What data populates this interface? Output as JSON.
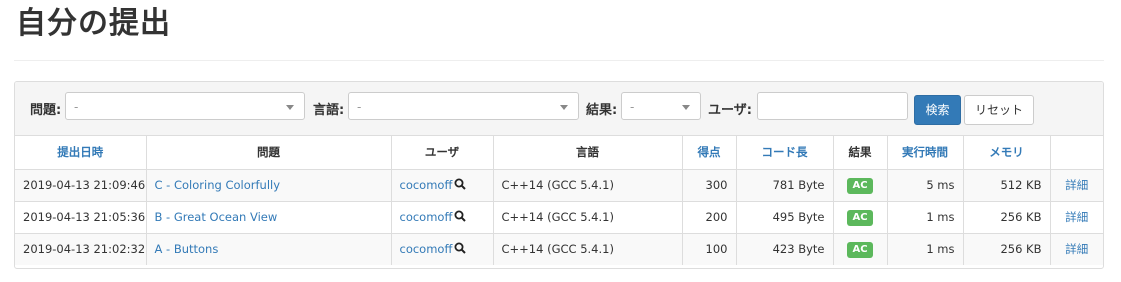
{
  "page": {
    "title": "自分の提出"
  },
  "filters": {
    "problem_label": "問題:",
    "problem_value": "-",
    "language_label": "言語:",
    "language_value": "-",
    "status_label": "結果:",
    "status_value": "-",
    "user_label": "ユーザ:",
    "user_value": "",
    "search_button": "検索",
    "reset_button": "リセット"
  },
  "table": {
    "headers": {
      "date": "提出日時",
      "problem": "問題",
      "user": "ユーザ",
      "language": "言語",
      "score": "得点",
      "code_length": "コード長",
      "status": "結果",
      "exec_time": "実行時間",
      "memory": "メモリ"
    },
    "rows": [
      {
        "date": "2019-04-13 21:09:46",
        "problem": "C - Coloring Colorfully",
        "user": "cocomoff",
        "language": "C++14 (GCC 5.4.1)",
        "score": "300",
        "code_length": "781 Byte",
        "status": "AC",
        "exec_time": "5 ms",
        "memory": "512 KB",
        "detail": "詳細"
      },
      {
        "date": "2019-04-13 21:05:36",
        "problem": "B - Great Ocean View",
        "user": "cocomoff",
        "language": "C++14 (GCC 5.4.1)",
        "score": "200",
        "code_length": "495 Byte",
        "status": "AC",
        "exec_time": "1 ms",
        "memory": "256 KB",
        "detail": "詳細"
      },
      {
        "date": "2019-04-13 21:02:32",
        "problem": "A - Buttons",
        "user": "cocomoff",
        "language": "C++14 (GCC 5.4.1)",
        "score": "100",
        "code_length": "423 Byte",
        "status": "AC",
        "exec_time": "1 ms",
        "memory": "256 KB",
        "detail": "詳細"
      }
    ]
  },
  "colors": {
    "link": "#337ab7",
    "accepted": "#5cb85c",
    "primary_button": "#337ab7"
  },
  "icons": {
    "user_search": "magnifier-icon",
    "select_caret": "caret-down-icon"
  }
}
